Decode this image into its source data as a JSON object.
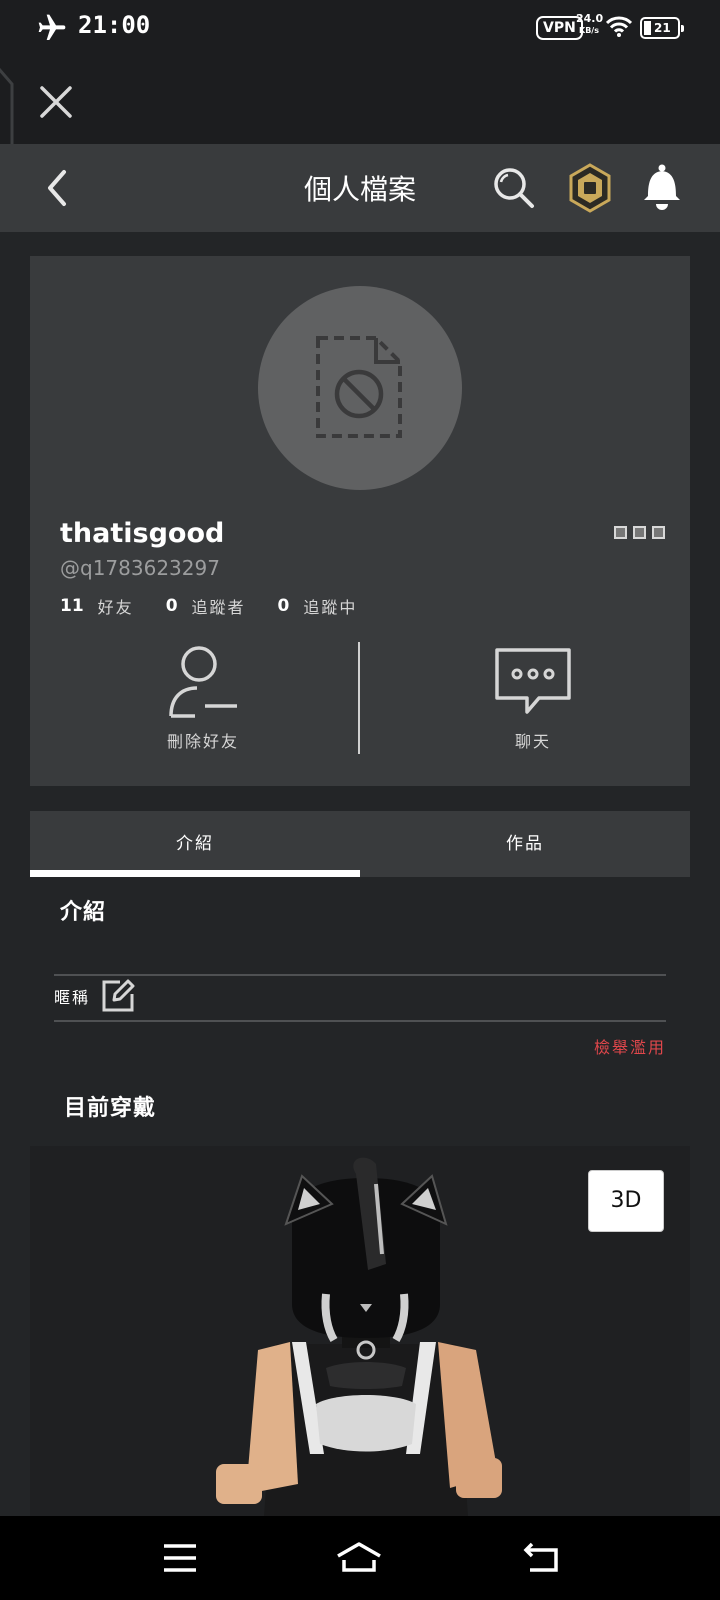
{
  "status_bar": {
    "time": "21:00",
    "vpn": "VPN",
    "speed_value": "24.0",
    "speed_unit": "KB/s",
    "battery": "21"
  },
  "header": {
    "title": "個人檔案"
  },
  "profile": {
    "username": "thatisgood",
    "handle": "@q1783623297",
    "stats": [
      {
        "count": "11",
        "label": "好友"
      },
      {
        "count": "0",
        "label": "追蹤者"
      },
      {
        "count": "0",
        "label": "追蹤中"
      }
    ],
    "actions": {
      "remove_friend": "刪除好友",
      "chat": "聊天"
    }
  },
  "tabs": [
    {
      "label": "介紹",
      "active": true
    },
    {
      "label": "作品",
      "active": false
    }
  ],
  "about": {
    "title": "介紹",
    "nickname_label": "暱稱",
    "report": "檢舉濫用"
  },
  "outfit": {
    "title": "目前穿戴",
    "view_3d": "3D"
  },
  "colors": {
    "background": "#232527",
    "card": "#393b3d",
    "report_red": "#e0474b",
    "robux_gold": "#c9a85a"
  }
}
